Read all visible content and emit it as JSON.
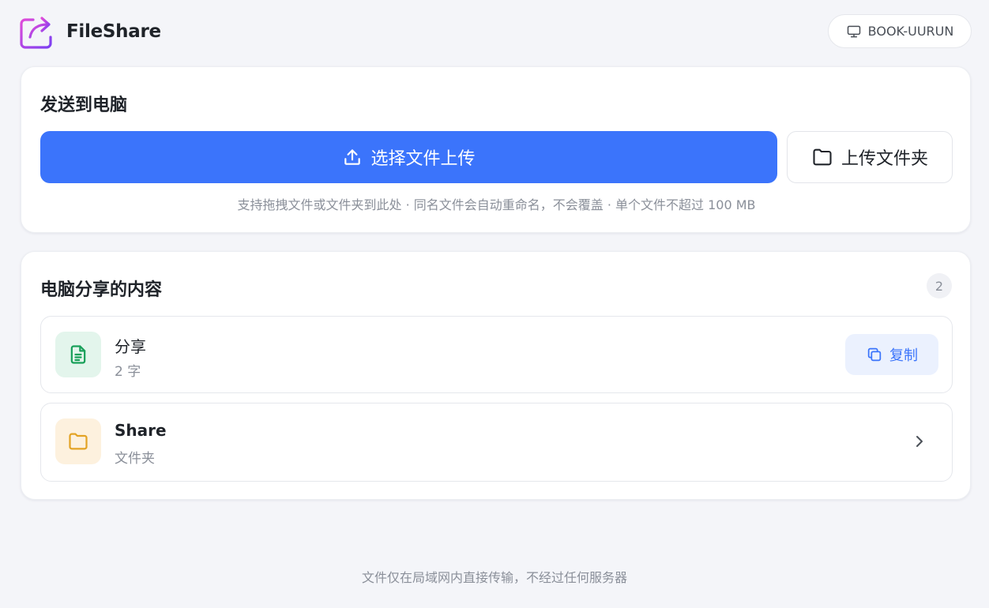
{
  "header": {
    "brand": "FileShare",
    "device_name": "BOOK-UURUN",
    "icons": {
      "logo": "share-arrow-icon",
      "device": "monitor-icon"
    }
  },
  "send": {
    "title": "发送到电脑",
    "upload_button": "选择文件上传",
    "upload_folder_button": "上传文件夹",
    "hint": "支持拖拽文件或文件夹到此处 · 同名文件会自动重命名，不会覆盖 · 单个文件不超过 100 MB",
    "icons": {
      "upload": "upload-icon",
      "folder": "folder-icon"
    }
  },
  "shared": {
    "title": "电脑分享的内容",
    "count": "2",
    "items": [
      {
        "name": "分享",
        "sub": "2 字",
        "type": "text",
        "icon": "text-file-icon",
        "action": "复制",
        "action_icon": "copy-icon"
      },
      {
        "name": "Share",
        "sub": "文件夹",
        "type": "folder",
        "icon": "folder-icon",
        "action_icon": "chevron-right-icon"
      }
    ]
  },
  "footer": {
    "text": "文件仅在局域网内直接传输，不经过任何服务器"
  },
  "colors": {
    "accent": "#3b74fb",
    "background": "#f4f5f9",
    "text_file_green": "#19a05a",
    "folder_orange": "#e3a325",
    "logo_gradient_start": "#e04bd9",
    "logo_gradient_end": "#7b3ff2"
  }
}
